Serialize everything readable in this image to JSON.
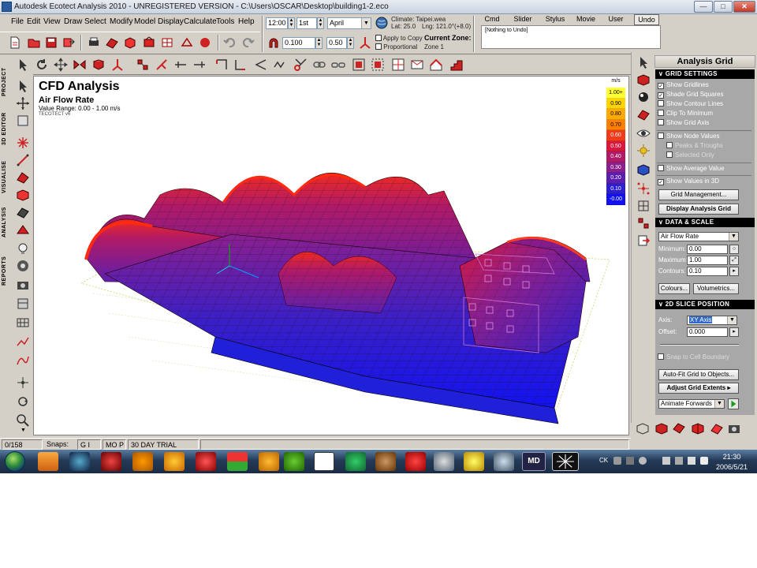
{
  "window": {
    "title": "Autodesk Ecotect Analysis 2010 - UNREGISTERED VERSION - C:\\Users\\OSCAR\\Desktop\\building1-2.eco",
    "controls": [
      "minimize-icon",
      "maximize-icon",
      "close-icon"
    ]
  },
  "menu": {
    "items": [
      "File",
      "Edit",
      "View",
      "Draw",
      "Select",
      "Modify",
      "Model",
      "Display",
      "Calculate",
      "Tools",
      "Help"
    ]
  },
  "datetime": {
    "time": "12:00",
    "day": "1st",
    "month": "April",
    "climate_label": "Climate: Taipei.wea",
    "lat": "Lat: 25.0",
    "lng": "Lng: 121.0°(+8.0)",
    "offset1": "0.100",
    "offset2": "0.50"
  },
  "apply": {
    "apply_to_copy": "Apply to Copy",
    "proportional": "Proportional",
    "current_zone_label": "Current Zone:",
    "current_zone_value": "Zone 1"
  },
  "command": {
    "tabs": [
      "Cmd",
      "Slider",
      "Stylus",
      "Movie",
      "User",
      "Undo"
    ],
    "active_tab": "Undo",
    "content": "[Nothing to Undo]"
  },
  "side_tabs": [
    "PROJECT",
    "3D EDITOR",
    "VISUALISE",
    "ANALYSIS",
    "REPORTS"
  ],
  "viz": {
    "title": "CFD Analysis",
    "subtitle": "Air Flow Rate",
    "range": "Value Range: 0.00 - 1.00 m/s",
    "version": "TECOTECT v6"
  },
  "legend": {
    "unit": "m/s",
    "entries": [
      {
        "label": "1.00+",
        "color": "#ffff33",
        "text": "#000000"
      },
      {
        "label": "0.90",
        "color": "#ffd500",
        "text": "#000000"
      },
      {
        "label": "0.80",
        "color": "#ffaa00",
        "text": "#000000"
      },
      {
        "label": "0.70",
        "color": "#ff7f00",
        "text": "#000000"
      },
      {
        "label": "0.60",
        "color": "#f23b1b",
        "text": "#ffffff"
      },
      {
        "label": "0.50",
        "color": "#d9183e",
        "text": "#ffffff"
      },
      {
        "label": "0.40",
        "color": "#b11a66",
        "text": "#ffffff"
      },
      {
        "label": "0.30",
        "color": "#8a1f8e",
        "text": "#ffffff"
      },
      {
        "label": "0.20",
        "color": "#5a1fb0",
        "text": "#ffffff"
      },
      {
        "label": "0.10",
        "color": "#2c1fd0",
        "text": "#ffffff"
      },
      {
        "label": "-0.00",
        "color": "#1212f0",
        "text": "#ffffff"
      }
    ]
  },
  "panel": {
    "title": "Analysis Grid",
    "grid_settings": {
      "header": "GRID SETTINGS",
      "checks": [
        {
          "label": "Show Gridlines",
          "checked": true
        },
        {
          "label": "Shade Grid Squares",
          "checked": true
        },
        {
          "label": "Show Contour Lines",
          "checked": false
        },
        {
          "label": "Clip To Minimum",
          "checked": false
        },
        {
          "label": "Show Grid Axis",
          "checked": false
        },
        {
          "label": "Show Node Values",
          "checked": false
        },
        {
          "label": "Peaks & Troughs",
          "checked": false
        },
        {
          "label": "Selected Only",
          "checked": false
        },
        {
          "label": "Show Average Value",
          "checked": false
        },
        {
          "label": "Show Values in 3D",
          "checked": true
        }
      ],
      "grid_management": "Grid Management...",
      "display_grid": "Display Analysis Grid"
    },
    "data_scale": {
      "header": "DATA & SCALE",
      "data_type": "Air Flow Rate",
      "minimum_label": "Minimum:",
      "minimum": "0.00",
      "maximum_label": "Maximum:",
      "maximum": "1.00",
      "contours_label": "Contours:",
      "contours": "0.10",
      "colours": "Colours...",
      "volumetrics": "Volumetrics..."
    },
    "slice": {
      "header": "2D SLICE POSITION",
      "axis_label": "Axis:",
      "axis": "XY Axis",
      "offset_label": "Offset:",
      "offset": "0.000",
      "snap_label": "Snap to Cell Boundary",
      "autofit": "Auto-Fit Grid to Objects...",
      "adjust": "Adjust Grid Extents",
      "animate": "Animate Forwards"
    }
  },
  "status": {
    "count": "0/158",
    "snaps_label": "Snaps:",
    "snaps_value": "G I",
    "mode": "MO P",
    "trial": "30 DAY TRIAL"
  },
  "taskbar": {
    "tray_lang": "CK",
    "time": "21:30",
    "date": "2006/5/21",
    "md_label": "MD"
  }
}
